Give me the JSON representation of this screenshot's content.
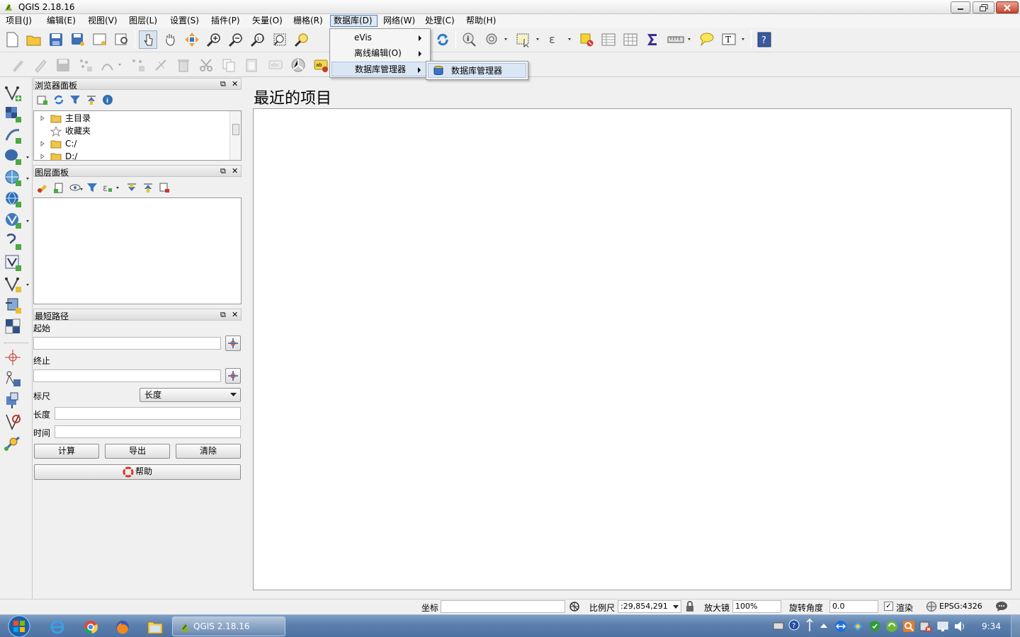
{
  "window": {
    "title": "QGIS 2.18.16"
  },
  "menubar": {
    "items": [
      "项目(J)",
      "编辑(E)",
      "视图(V)",
      "图层(L)",
      "设置(S)",
      "插件(P)",
      "矢量(O)",
      "栅格(R)",
      "数据库(D)",
      "网络(W)",
      "处理(C)",
      "帮助(H)"
    ],
    "open_item": "数据库(D)"
  },
  "database_menu": {
    "items": [
      "eVis",
      "离线编辑(O)",
      "数据库管理器"
    ],
    "submenu_item": "数据库管理器"
  },
  "browser_panel": {
    "title": "浏览器面板",
    "tree": [
      "主目录",
      "收藏夹",
      "C:/",
      "D:/"
    ]
  },
  "layers_panel": {
    "title": "图层面板"
  },
  "shortest_path_panel": {
    "title": "最短路径",
    "start_label": "起始",
    "end_label": "终止",
    "criterion_label": "标尺",
    "criterion_value": "长度",
    "length_label": "长度",
    "time_label": "时间",
    "calculate_button": "计算",
    "export_button": "导出",
    "clear_button": "清除",
    "help_button": "帮助"
  },
  "main": {
    "recent_projects_title": "最近的项目"
  },
  "statusbar": {
    "coordinate_label": "坐标",
    "coordinate_value": "",
    "scale_label": "比例尺",
    "scale_value": ":29,854,291",
    "magnifier_label": "放大镜",
    "magnifier_value": "100%",
    "rotation_label": "旋转角度",
    "rotation_value": "0.0",
    "render_label": "渲染",
    "render_checked": true,
    "crs": "EPSG:4326"
  },
  "taskbar": {
    "task_label": "QGIS 2.18.16",
    "clock": "9:34"
  }
}
